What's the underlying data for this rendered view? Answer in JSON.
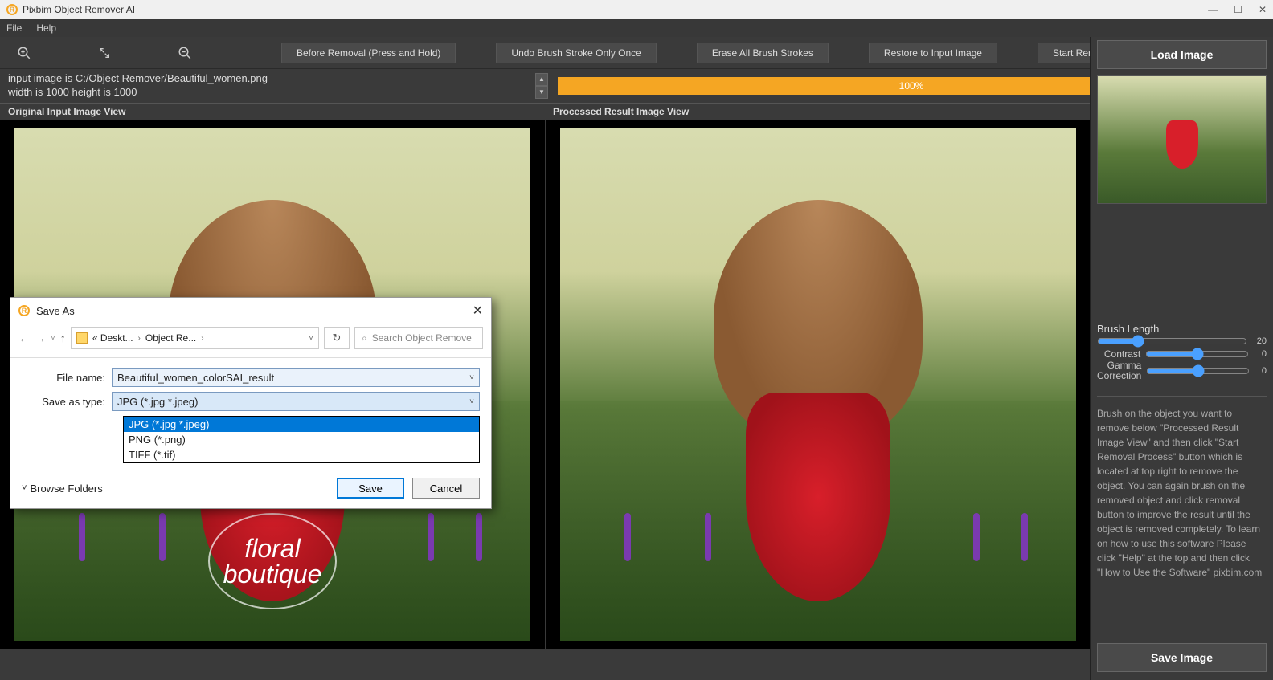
{
  "app": {
    "title": "Pixbim Object Remover AI"
  },
  "menu": {
    "file": "File",
    "help": "Help"
  },
  "toolbar": {
    "zoom_in": "zoom-in",
    "fullscreen": "fullscreen",
    "zoom_out": "zoom-out",
    "before": "Before Removal (Press and Hold)",
    "undo": "Undo Brush Stroke Only Once",
    "erase": "Erase All Brush Strokes",
    "restore": "Restore to Input Image",
    "start": "Start Removal Process"
  },
  "info": {
    "path": "input image is C:/Object Remover/Beautiful_women.png",
    "dims": "width is 1000 height is 1000",
    "progress": "100%"
  },
  "views": {
    "original": "Original Input Image View",
    "processed": "Processed Result Image View",
    "watermark_line1": "floral",
    "watermark_line2": "boutique"
  },
  "sidebar": {
    "load": "Load Image",
    "brush_length_label": "Brush Length",
    "brush_length_value": "20",
    "contrast_label": "Contrast",
    "contrast_value": "0",
    "gamma_label": "Gamma Correction",
    "gamma_value": "0",
    "help": "Brush on the object you want to remove below \"Processed Result Image View\" and then click \"Start Removal Process\" button which is located at top right to remove the object.\n You can again brush on the removed object and click removal button to improve the result until the object is removed completely. To learn on how to use this software Please click \"Help\" at the top and then click \"How to Use the Software\" pixbim.com",
    "save": "Save Image"
  },
  "dialog": {
    "title": "Save As",
    "crumb1": "« Deskt...",
    "crumb2": "Object Re...",
    "search_placeholder": "Search Object Remove",
    "filename_label": "File name:",
    "filename_value": "Beautiful_women_colorSAI_result",
    "type_label": "Save as type:",
    "type_value": "JPG (*.jpg *.jpeg)",
    "options": [
      "JPG (*.jpg *.jpeg)",
      "PNG (*.png)",
      "TIFF (*.tif)"
    ],
    "browse": "Browse Folders",
    "save": "Save",
    "cancel": "Cancel"
  }
}
